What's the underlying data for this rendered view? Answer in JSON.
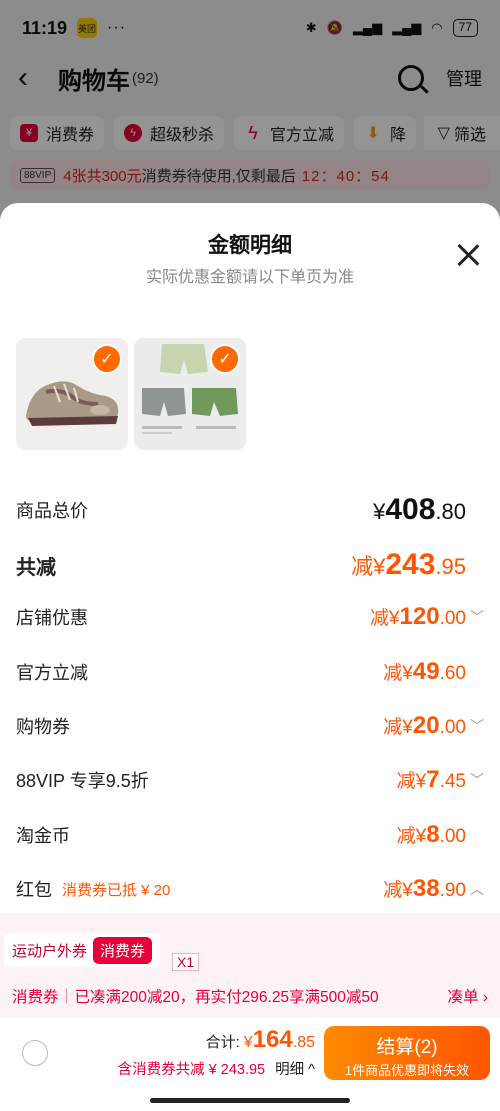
{
  "status_bar": {
    "time": "11:19",
    "app_badge": "美团",
    "battery": "77",
    "network": "5G"
  },
  "header": {
    "title": "购物车",
    "count": "(92)",
    "manage": "管理"
  },
  "filters": [
    {
      "label": "消费券",
      "icon": "coupon-icon",
      "color": "#e6003c"
    },
    {
      "label": "超级秒杀",
      "icon": "flash-icon",
      "color": "#e6003c"
    },
    {
      "label": "官方立减",
      "icon": "bolt-icon",
      "color": "#e6003c"
    },
    {
      "label": "降",
      "icon": "down-arrow-icon",
      "color": "#f5a000"
    }
  ],
  "filter_button": "筛选",
  "vip_banner": {
    "tag": "88VIP",
    "highlight": "4张共300元",
    "text": "消费券待使用,仅剩最后",
    "timer": "12：40：54"
  },
  "sheet": {
    "title": "金额明细",
    "subtitle": "实际优惠金额请以下单页为准",
    "products": [
      {
        "name": "sneaker",
        "checked": true
      },
      {
        "name": "shorts-set",
        "checked": true
      }
    ],
    "rows": [
      {
        "key": "total",
        "label": "商品总价",
        "prefix": "¥",
        "int": "408",
        "dec": ".80",
        "chevron": false
      },
      {
        "key": "reduce",
        "label": "共减",
        "prefix": "减¥",
        "int": "243",
        "dec": ".95",
        "chevron": false
      },
      {
        "key": "shop",
        "label": "店铺优惠",
        "prefix": "减¥",
        "int": "120",
        "dec": ".00",
        "chevron": "down"
      },
      {
        "key": "official",
        "label": "官方立减",
        "prefix": "减¥",
        "int": "49",
        "dec": ".60",
        "chevron": false
      },
      {
        "key": "shopping",
        "label": "购物券",
        "prefix": "减¥",
        "int": "20",
        "dec": ".00",
        "chevron": "down"
      },
      {
        "key": "vip",
        "label": "88VIP 专享9.5折",
        "prefix": "减¥",
        "int": "7",
        "dec": ".45",
        "chevron": "down"
      },
      {
        "key": "coin",
        "label": "淘金币",
        "prefix": "减¥",
        "int": "8",
        "dec": ".00",
        "chevron": false
      },
      {
        "key": "redpack",
        "label": "红包",
        "note": "消费券已抵 ¥ 20",
        "prefix": "减¥",
        "int": "38",
        "dec": ".90",
        "chevron": "up"
      }
    ]
  },
  "coupon": {
    "name": "运动户外券",
    "badge": "消费券",
    "qty": "X1",
    "strip_label": "消费券",
    "strip_text": "已凑满200减20，再实付296.25享满500减50",
    "strip_action": "凑单 ›"
  },
  "bottom": {
    "total_label": "合计:",
    "total_prefix": "¥",
    "total_int": "164",
    "total_dec": ".85",
    "sub_text": "含消费券共减 ¥ 243.95",
    "detail": "明细 ^",
    "checkout": "结算(2)",
    "checkout_sub": "1件商品优惠即将失效"
  }
}
